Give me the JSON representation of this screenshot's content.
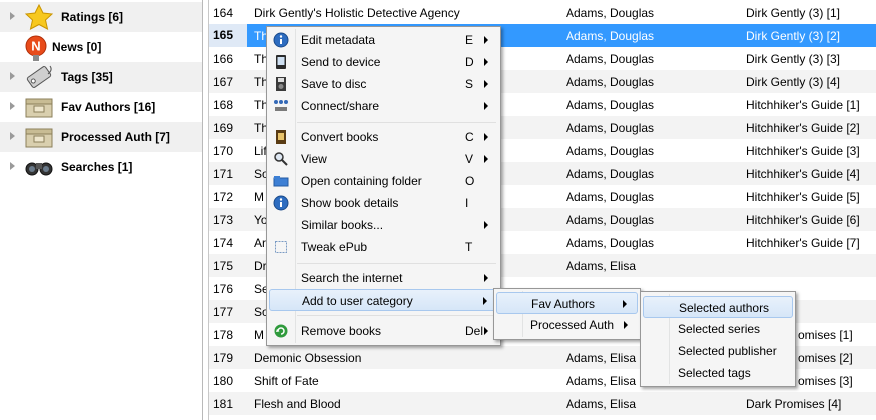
{
  "sidebar": {
    "items": [
      {
        "label": "Ratings [6]",
        "icon": "star-icon"
      },
      {
        "label": "News [0]",
        "icon": "news-icon"
      },
      {
        "label": "Tags [35]",
        "icon": "tag-icon"
      },
      {
        "label": "Fav Authors [16]",
        "icon": "category-box-icon"
      },
      {
        "label": "Processed Auth [7]",
        "icon": "category-box-icon"
      },
      {
        "label": "Searches [1]",
        "icon": "binoculars-icon"
      }
    ]
  },
  "books": {
    "rows": [
      {
        "num": "164",
        "title": "Dirk Gently's Holistic Detective Agency",
        "author": "Adams, Douglas",
        "series": "Dirk Gently (3) [1]"
      },
      {
        "num": "165",
        "title": "Th",
        "author": "Adams, Douglas",
        "series": "Dirk Gently (3) [2]"
      },
      {
        "num": "166",
        "title": "Th",
        "author": "Adams, Douglas",
        "series": "Dirk Gently (3) [3]"
      },
      {
        "num": "167",
        "title": "Th",
        "author": "Adams, Douglas",
        "series": "Dirk Gently (3) [4]"
      },
      {
        "num": "168",
        "title": "Th",
        "author": "Adams, Douglas",
        "series": "Hitchhiker's Guide [1]"
      },
      {
        "num": "169",
        "title": "Th",
        "author": "Adams, Douglas",
        "series": "Hitchhiker's Guide [2]"
      },
      {
        "num": "170",
        "title": "Lif",
        "author": "Adams, Douglas",
        "series": "Hitchhiker's Guide [3]"
      },
      {
        "num": "171",
        "title": "So",
        "author": "Adams, Douglas",
        "series": "Hitchhiker's Guide [4]"
      },
      {
        "num": "172",
        "title": "M",
        "author": "Adams, Douglas",
        "series": "Hitchhiker's Guide [5]"
      },
      {
        "num": "173",
        "title": "Yo",
        "author": "Adams, Douglas",
        "series": "Hitchhiker's Guide [6]"
      },
      {
        "num": "174",
        "title": "Ar",
        "author": "Adams, Douglas",
        "series": "Hitchhiker's Guide [7]"
      },
      {
        "num": "175",
        "title": "Dr",
        "author": "Adams, Elisa",
        "series": ""
      },
      {
        "num": "176",
        "title": "Se",
        "author": "",
        "series": ""
      },
      {
        "num": "177",
        "title": "So",
        "author": "",
        "series": ""
      },
      {
        "num": "178",
        "title": "M",
        "author": "",
        "series": "omises [1]"
      },
      {
        "num": "179",
        "title": "Demonic Obsession",
        "author": "Adams, Elisa",
        "series": "omises [2]"
      },
      {
        "num": "180",
        "title": "Shift of Fate",
        "author": "Adams, Elisa",
        "series": "omises [3]"
      },
      {
        "num": "181",
        "title": "Flesh and Blood",
        "author": "Adams, Elisa",
        "series": "Dark Promises [4]"
      }
    ],
    "selected_index": 1
  },
  "context_menu": {
    "items": [
      {
        "label": "Edit metadata",
        "shortcut": "E",
        "submenu": true,
        "icon": "info-icon"
      },
      {
        "label": "Send to device",
        "shortcut": "D",
        "submenu": true,
        "icon": "device-icon"
      },
      {
        "label": "Save to disc",
        "shortcut": "S",
        "submenu": true,
        "icon": "floppy-disk-icon"
      },
      {
        "label": "Connect/share",
        "shortcut": "",
        "submenu": true,
        "icon": "network-icon"
      },
      {
        "label": "Convert books",
        "shortcut": "C",
        "submenu": true,
        "icon": "convert-icon"
      },
      {
        "label": "View",
        "shortcut": "V",
        "submenu": true,
        "icon": "magnifier-icon"
      },
      {
        "label": "Open containing folder",
        "shortcut": "O",
        "submenu": false,
        "icon": "folder-icon"
      },
      {
        "label": "Show book details",
        "shortcut": "I",
        "submenu": false,
        "icon": "info-icon"
      },
      {
        "label": "Similar books...",
        "shortcut": "",
        "submenu": true,
        "icon": ""
      },
      {
        "label": "Tweak ePub",
        "shortcut": "T",
        "submenu": false,
        "icon": "tweak-icon"
      },
      {
        "label": "Search the internet",
        "shortcut": "",
        "submenu": true,
        "icon": ""
      },
      {
        "label": "Add to user category",
        "shortcut": "",
        "submenu": true,
        "icon": ""
      },
      {
        "label": "Remove books",
        "shortcut": "Del",
        "submenu": true,
        "icon": "recycle-icon"
      }
    ]
  },
  "category_submenu": {
    "items": [
      {
        "label": "Fav Authors",
        "submenu": true
      },
      {
        "label": "Processed Auth",
        "submenu": true
      }
    ]
  },
  "fav_authors_submenu": {
    "items": [
      {
        "label": "Selected authors"
      },
      {
        "label": "Selected series"
      },
      {
        "label": "Selected publisher"
      },
      {
        "label": "Selected tags"
      }
    ]
  },
  "colors": {
    "selection": "#3399ff",
    "menu_bg": "#f5f5f5",
    "menu_highlight": "#d6e6f8"
  }
}
